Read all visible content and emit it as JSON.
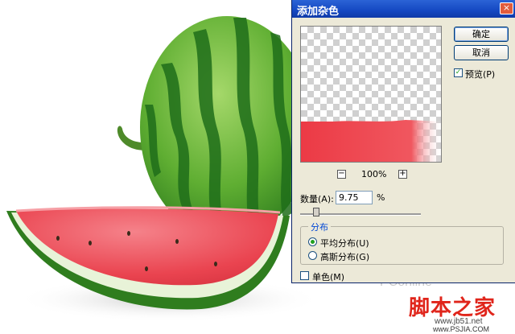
{
  "dialog": {
    "title": "添加杂色",
    "close_label": "×",
    "ok_label": "确定",
    "cancel_label": "取消",
    "preview_label": "预览(P)",
    "preview_checked": true,
    "zoom_out_label": "−",
    "zoom_in_label": "+",
    "zoom_level": "100%",
    "amount_label": "数量(A):",
    "amount_value": "9.75",
    "amount_unit": "%",
    "amount_slider_fraction": 0.13,
    "distribution": {
      "title": "分布",
      "options": [
        "平均分布(U)",
        "高斯分布(G)"
      ],
      "selected": 0
    },
    "monochrome_label": "单色(M)",
    "monochrome_checked": false
  },
  "watermark": {
    "pconline": "PConline",
    "site_cn": "脚本之家",
    "site_url": "www.jb51.net",
    "ps_url": "www.PSJIA.COM"
  },
  "colors": {
    "title_bar": "#1548c2",
    "dialog_bg": "#ece9d8",
    "melon_green": "#2e8b2e",
    "melon_red": "#ef3f49"
  }
}
